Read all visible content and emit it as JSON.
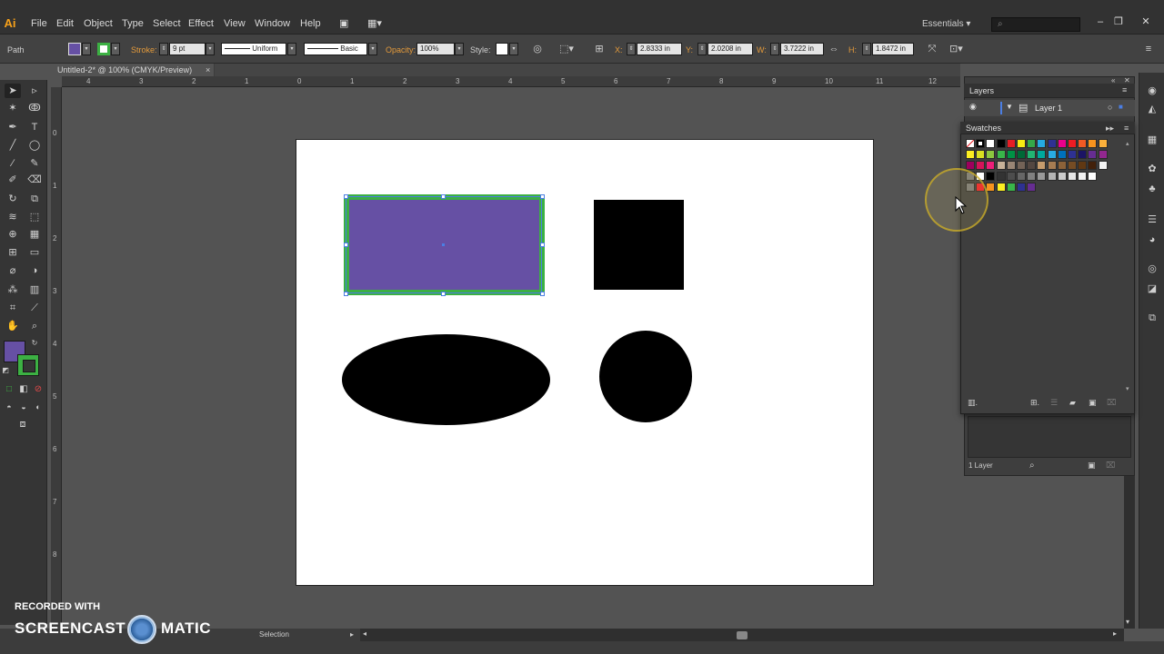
{
  "app": {
    "logo_text": "Ai"
  },
  "menubar": {
    "items": [
      "File",
      "Edit",
      "Object",
      "Type",
      "Select",
      "Effect",
      "View",
      "Window",
      "Help"
    ],
    "workspace": "Essentials",
    "workspace_arrow": "▾",
    "window_buttons": [
      "–",
      "❐",
      "✕"
    ]
  },
  "controlbar": {
    "selection_type": "Path",
    "stroke_label": "Stroke:",
    "stroke_weight": "9 pt",
    "profile": "Uniform",
    "brush": "Basic",
    "opacity_label": "Opacity:",
    "opacity": "100%",
    "style_label": "Style:",
    "x_label": "X:",
    "x": "2.8333 in",
    "y_label": "Y:",
    "y": "2.0208 in",
    "w_label": "W:",
    "w": "3.7222 in",
    "h_label": "H:",
    "h": "1.8472 in"
  },
  "document": {
    "tab_title": "Untitled-2* @ 100% (CMYK/Preview)",
    "close": "×"
  },
  "rulers": {
    "top": [
      "4",
      "3",
      "2",
      "1",
      "0",
      "1",
      "2",
      "3",
      "4",
      "5",
      "6",
      "7",
      "8",
      "9",
      "10",
      "11",
      "12"
    ],
    "left": [
      "0",
      "1",
      "2",
      "3",
      "4",
      "5",
      "6",
      "7",
      "8"
    ]
  },
  "colors": {
    "fill": "#6650a4",
    "stroke": "#3cb043",
    "selection": "#4b7ee3",
    "accent": "#f7a11a"
  },
  "tools": [
    "selection-tool",
    "direct-selection-tool",
    "magic-wand-tool",
    "lasso-tool",
    "pen-tool",
    "type-tool",
    "line-tool",
    "ellipse-tool",
    "paintbrush-tool",
    "pencil-tool",
    "blob-brush-tool",
    "eraser-tool",
    "rotate-tool",
    "scale-tool",
    "width-tool",
    "free-transform-tool",
    "shape-builder-tool",
    "perspective-grid-tool",
    "mesh-tool",
    "gradient-tool",
    "eyedropper-tool",
    "blend-tool",
    "symbol-sprayer-tool",
    "column-graph-tool",
    "artboard-tool",
    "slice-tool",
    "hand-tool",
    "zoom-tool"
  ],
  "layers": {
    "title": "Layers",
    "layer_name": "Layer 1",
    "count": "1 Layer"
  },
  "swatches": {
    "title": "Swatches"
  },
  "status": {
    "tool": "Selection"
  },
  "watermark": {
    "recorded": "RECORDED WITH",
    "brand_left": "SCREENCAST",
    "brand_right": "MATIC"
  }
}
